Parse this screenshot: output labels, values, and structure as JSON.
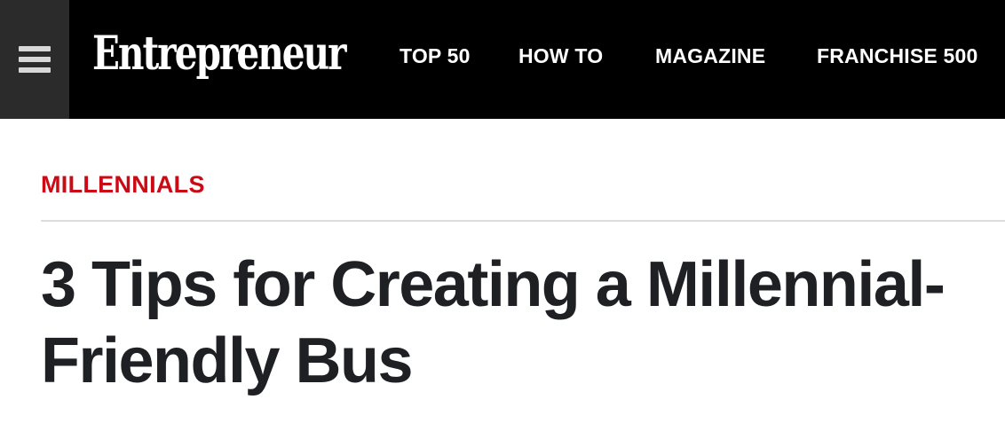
{
  "header": {
    "menu_icon": "hamburger-menu-icon",
    "logo_text": "Entrepreneur",
    "nav": [
      {
        "label": "TOP 50"
      },
      {
        "label": "HOW TO"
      },
      {
        "label": "MAGAZINE"
      },
      {
        "label": "FRANCHISE 500"
      }
    ]
  },
  "article": {
    "category": "MILLENNIALS",
    "title": "3 Tips for Creating a Millennial-Friendly Bus"
  },
  "colors": {
    "header_bg": "#000000",
    "menu_bg": "#2b2b2b",
    "category": "#cc0a15",
    "headline": "#1f2024"
  }
}
